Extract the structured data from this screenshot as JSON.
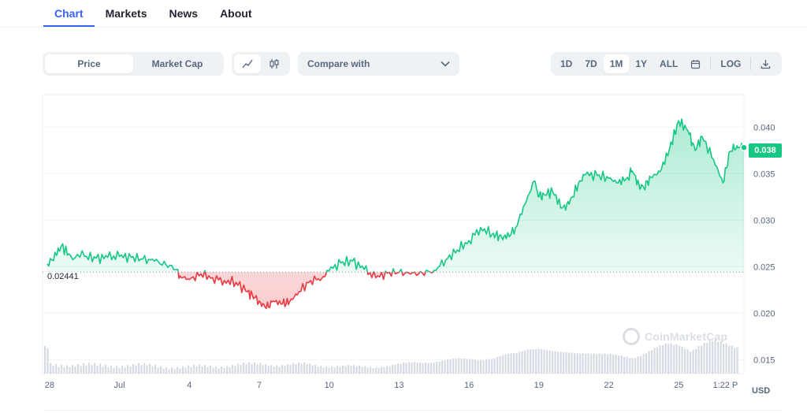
{
  "tabs": [
    {
      "label": "Chart",
      "active": true
    },
    {
      "label": "Markets",
      "active": false
    },
    {
      "label": "News",
      "active": false
    },
    {
      "label": "About",
      "active": false
    }
  ],
  "toolbar": {
    "metric": {
      "price": "Price",
      "market_cap": "Market Cap",
      "selected": "Price"
    },
    "chart_type": {
      "line_icon": "line-chart-icon",
      "candle_icon": "candlestick-icon",
      "selected": "line"
    },
    "compare_label": "Compare with",
    "ranges": [
      "1D",
      "7D",
      "1M",
      "1Y",
      "ALL"
    ],
    "selected_range": "1M",
    "calendar_icon": "calendar-icon",
    "log_label": "LOG",
    "download_icon": "download-icon"
  },
  "chart_data": {
    "type": "line",
    "currency": "USD",
    "current_price_label": "0.038",
    "reference": {
      "label": "0.02441",
      "value": 0.02441
    },
    "ylim": [
      0.0135,
      0.0435
    ],
    "yticks": [
      "0.040",
      "0.035",
      "0.030",
      "0.025",
      "0.020",
      "0.015"
    ],
    "xlim": [
      -0.3,
      27.3
    ],
    "xticks": [
      {
        "label": "28",
        "x": 0
      },
      {
        "label": "Jul",
        "x": 3
      },
      {
        "label": "4",
        "x": 6
      },
      {
        "label": "7",
        "x": 9
      },
      {
        "label": "10",
        "x": 12
      },
      {
        "label": "13",
        "x": 15
      },
      {
        "label": "16",
        "x": 18
      },
      {
        "label": "19",
        "x": 21
      },
      {
        "label": "22",
        "x": 24
      },
      {
        "label": "25",
        "x": 27
      },
      {
        "label": "1:22 P",
        "x": 29
      }
    ],
    "series": [
      {
        "x": [
          -0.1,
          0.3,
          0.5,
          0.9,
          1.5,
          2.0,
          2.5,
          3.0,
          3.5,
          4.0,
          4.5,
          5.0,
          5.5,
          5.6,
          6.0,
          6.5,
          7.0,
          7.5,
          8.0,
          8.5,
          8.8,
          9.0,
          9.3,
          9.6,
          10.0,
          10.3,
          10.7,
          11.2,
          11.7,
          12.0,
          12.5,
          13.0,
          13.5,
          14.0,
          14.5,
          15.0,
          15.5,
          16.0,
          16.5,
          17.0,
          17.5,
          18.0,
          18.5,
          19.0,
          19.3,
          19.6,
          20.0,
          20.4,
          20.8,
          21.0,
          21.2,
          21.6,
          22.0,
          22.3,
          22.7,
          23.0,
          23.5,
          24.0,
          24.4,
          24.8,
          25.0,
          25.3,
          25.5,
          25.8,
          26.2,
          26.6,
          27.0,
          27.4,
          27.7,
          28.0,
          28.5,
          28.9,
          29.2,
          29.5,
          29.8
        ],
        "y": [
          0.0253,
          0.0262,
          0.0272,
          0.0262,
          0.0261,
          0.0259,
          0.026,
          0.0261,
          0.026,
          0.0258,
          0.0256,
          0.0252,
          0.0247,
          0.024,
          0.0236,
          0.0242,
          0.0238,
          0.0235,
          0.0233,
          0.0223,
          0.0217,
          0.0213,
          0.0205,
          0.0213,
          0.021,
          0.0212,
          0.0223,
          0.0235,
          0.0238,
          0.0246,
          0.0254,
          0.0256,
          0.0247,
          0.0238,
          0.0243,
          0.0244,
          0.0242,
          0.0243,
          0.0246,
          0.0257,
          0.0268,
          0.0278,
          0.0292,
          0.0285,
          0.0283,
          0.028,
          0.0292,
          0.0317,
          0.0342,
          0.0325,
          0.0328,
          0.033,
          0.0313,
          0.0317,
          0.034,
          0.0349,
          0.0348,
          0.0345,
          0.034,
          0.0346,
          0.0353,
          0.0338,
          0.0335,
          0.0346,
          0.0352,
          0.0376,
          0.0407,
          0.0396,
          0.0375,
          0.039,
          0.0365,
          0.034,
          0.0374,
          0.038,
          0.0378
        ]
      },
      {
        "name": "Volume",
        "x": [
          -0.1,
          1,
          2,
          3,
          4,
          5,
          6,
          7,
          8,
          9,
          10,
          11,
          12,
          13,
          14,
          15,
          16,
          17,
          18,
          19,
          20,
          20.5,
          21,
          21.5,
          22,
          23,
          24,
          25,
          26,
          26.5,
          27,
          27.5,
          28,
          28.5,
          29,
          29.8
        ],
        "y": [
          0.25,
          0.24,
          0.22,
          0.22,
          0.23,
          0.18,
          0.18,
          0.2,
          0.23,
          0.27,
          0.24,
          0.25,
          0.21,
          0.18,
          0.2,
          0.24,
          0.33,
          0.36,
          0.4,
          0.42,
          0.55,
          0.7,
          0.72,
          0.6,
          0.55,
          0.6,
          0.5,
          0.45,
          0.7,
          0.8,
          0.78,
          0.65,
          0.82,
          0.88,
          0.8,
          0.7
        ]
      }
    ]
  }
}
